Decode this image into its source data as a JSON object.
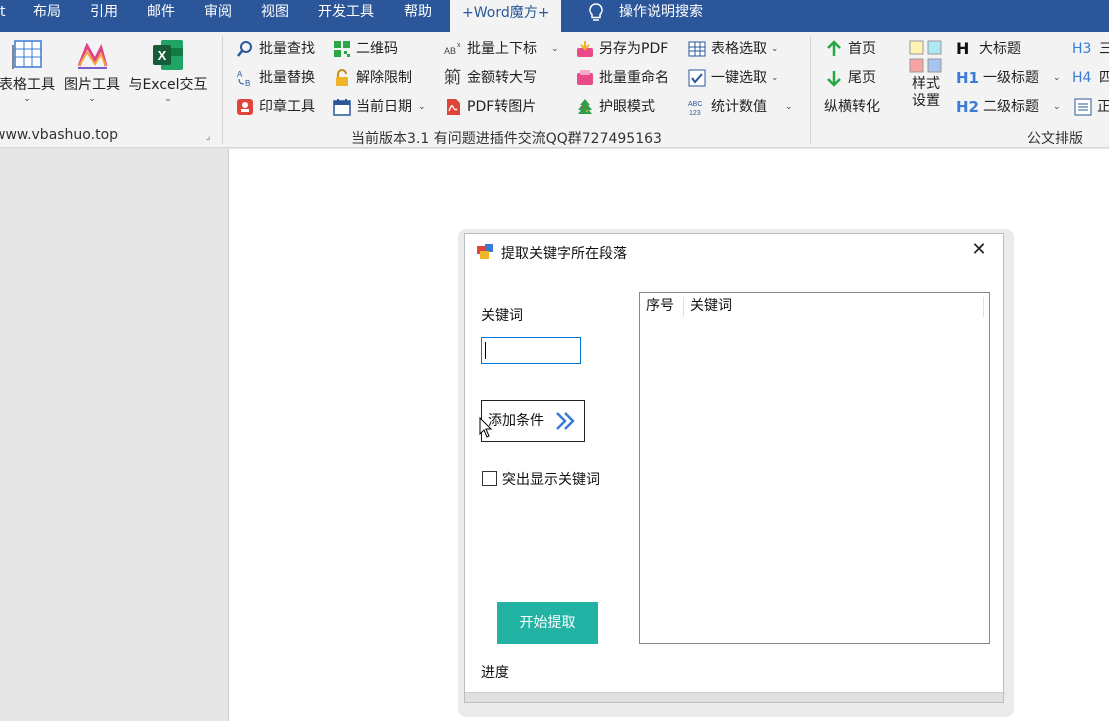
{
  "tabs": [
    {
      "label": "t",
      "active": false
    },
    {
      "label": "布局",
      "active": false
    },
    {
      "label": "引用",
      "active": false
    },
    {
      "label": "邮件",
      "active": false
    },
    {
      "label": "审阅",
      "active": false
    },
    {
      "label": "视图",
      "active": false
    },
    {
      "label": "开发工具",
      "active": false
    },
    {
      "label": "帮助",
      "active": false
    },
    {
      "label": "+Word魔方+",
      "active": true
    },
    {
      "label": "操作说明搜索",
      "active": false
    }
  ],
  "ribbon": {
    "big_buttons": {
      "table_tools": "表格工具",
      "image_tools": "图片工具",
      "excel_interact": "与Excel交互"
    },
    "website": "www.vbashuo.top",
    "col1": [
      "批量查找",
      "批量替换",
      "印章工具"
    ],
    "col2": [
      "二维码",
      "解除限制",
      "当前日期"
    ],
    "col3": [
      "批量上下标",
      "金额转大写",
      "PDF转图片"
    ],
    "col4": [
      "另存为PDF",
      "批量重命名",
      "护眼模式"
    ],
    "col5": [
      "表格选取",
      "一键选取",
      "统计数值"
    ],
    "col6": [
      "首页",
      "尾页",
      "纵横转化"
    ],
    "style_settings": "样式设置",
    "style_settings_line1": "样式",
    "style_settings_line2": "设置",
    "headings": [
      "大标题",
      "一级标题",
      "二级标题"
    ],
    "headings_partial": [
      "三",
      "四",
      "正"
    ],
    "version_info": "当前版本3.1 有问题进插件交流QQ群727495163",
    "group_official": "公文排版",
    "icon_texts": {
      "ab": "AB",
      "h_big": "H",
      "h1": "H1",
      "h2": "H2",
      "h3": "H3",
      "h4": "H4",
      "abc": "ABC",
      "num123": "123"
    }
  },
  "dialog": {
    "title": "提取关键字所在段落",
    "close_symbol": "✕",
    "keyword_label": "关键词",
    "keyword_value": "",
    "add_condition": "添加条件",
    "highlight_label": "突出显示关键词",
    "highlight_checked": false,
    "start_button": "开始提取",
    "progress_label": "进度",
    "progress_value": 0,
    "list_columns": [
      "序号",
      "关键词"
    ]
  },
  "colors": {
    "accent": "#2b579a",
    "start_button": "#22b3a4",
    "input_border": "#0078d7"
  }
}
